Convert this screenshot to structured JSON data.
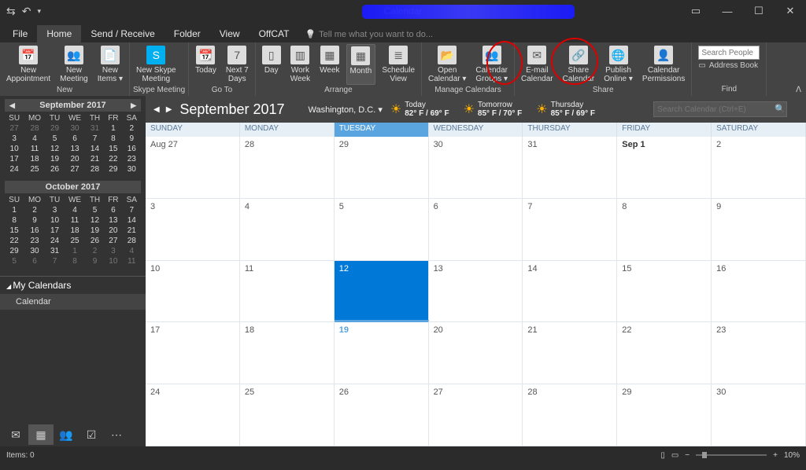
{
  "titlebar": {
    "title": "Calendar"
  },
  "tabs": [
    "File",
    "Home",
    "Send / Receive",
    "Folder",
    "View",
    "OffCAT"
  ],
  "active_tab": "Home",
  "tellme": "Tell me what you want to do...",
  "ribbon": {
    "new": {
      "label": "New",
      "appointment": "New\nAppointment",
      "meeting": "New\nMeeting",
      "items": "New\nItems ▾"
    },
    "skype": {
      "label": "Skype Meeting",
      "btn": "New Skype\nMeeting"
    },
    "goto": {
      "label": "Go To",
      "today": "Today",
      "next7": "Next 7\nDays"
    },
    "arrange": {
      "label": "Arrange",
      "day": "Day",
      "workweek": "Work\nWeek",
      "week": "Week",
      "month": "Month",
      "schedule": "Schedule\nView"
    },
    "manage": {
      "label": "Manage Calendars",
      "open": "Open\nCalendar ▾",
      "groups": "Calendar\nGroups ▾"
    },
    "share": {
      "label": "Share",
      "email": "E-mail\nCalendar",
      "sharebtn": "Share\nCalendar",
      "publish": "Publish\nOnline ▾",
      "perms": "Calendar\nPermissions"
    },
    "find": {
      "label": "Find",
      "search_ph": "Search People",
      "addressbook": "Address Book"
    }
  },
  "minical1": {
    "title": "September 2017",
    "dows": [
      "SU",
      "MO",
      "TU",
      "WE",
      "TH",
      "FR",
      "SA"
    ],
    "rows": [
      [
        "27",
        "28",
        "29",
        "30",
        "31",
        "1",
        "2"
      ],
      [
        "3",
        "4",
        "5",
        "6",
        "7",
        "8",
        "9"
      ],
      [
        "10",
        "11",
        "12",
        "13",
        "14",
        "15",
        "16"
      ],
      [
        "17",
        "18",
        "19",
        "20",
        "21",
        "22",
        "23"
      ],
      [
        "24",
        "25",
        "26",
        "27",
        "28",
        "29",
        "30"
      ]
    ],
    "sel": "19"
  },
  "minical2": {
    "title": "October 2017",
    "dows": [
      "SU",
      "MO",
      "TU",
      "WE",
      "TH",
      "FR",
      "SA"
    ],
    "rows": [
      [
        "1",
        "2",
        "3",
        "4",
        "5",
        "6",
        "7"
      ],
      [
        "8",
        "9",
        "10",
        "11",
        "12",
        "13",
        "14"
      ],
      [
        "15",
        "16",
        "17",
        "18",
        "19",
        "20",
        "21"
      ],
      [
        "22",
        "23",
        "24",
        "25",
        "26",
        "27",
        "28"
      ],
      [
        "29",
        "30",
        "31",
        "1",
        "2",
        "3",
        "4"
      ],
      [
        "5",
        "6",
        "7",
        "8",
        "9",
        "10",
        "11"
      ]
    ]
  },
  "mycalendars": {
    "header": "My Calendars",
    "item": "Calendar"
  },
  "calheader": {
    "month": "September 2017",
    "location": "Washington,  D.C.  ▾",
    "weather": [
      {
        "label": "Today",
        "temp": "82° F / 69° F"
      },
      {
        "label": "Tomorrow",
        "temp": "85° F / 70° F"
      },
      {
        "label": "Thursday",
        "temp": "85° F / 69° F"
      }
    ],
    "search_ph": "Search Calendar (Ctrl+E)"
  },
  "days": [
    "SUNDAY",
    "MONDAY",
    "TUESDAY",
    "WEDNESDAY",
    "THURSDAY",
    "FRIDAY",
    "SATURDAY"
  ],
  "selected_day_idx": 2,
  "grid": [
    [
      {
        "t": "Aug 27"
      },
      {
        "t": "28"
      },
      {
        "t": "29"
      },
      {
        "t": "30"
      },
      {
        "t": "31"
      },
      {
        "t": "Sep 1",
        "b": true
      },
      {
        "t": "2"
      }
    ],
    [
      {
        "t": "3"
      },
      {
        "t": "4"
      },
      {
        "t": "5"
      },
      {
        "t": "6"
      },
      {
        "t": "7"
      },
      {
        "t": "8"
      },
      {
        "t": "9"
      }
    ],
    [
      {
        "t": "10"
      },
      {
        "t": "11"
      },
      {
        "t": "12",
        "sel": true
      },
      {
        "t": "13"
      },
      {
        "t": "14"
      },
      {
        "t": "15"
      },
      {
        "t": "16"
      }
    ],
    [
      {
        "t": "17"
      },
      {
        "t": "18"
      },
      {
        "t": "19",
        "today": true
      },
      {
        "t": "20"
      },
      {
        "t": "21"
      },
      {
        "t": "22"
      },
      {
        "t": "23"
      }
    ],
    [
      {
        "t": "24"
      },
      {
        "t": "25"
      },
      {
        "t": "26"
      },
      {
        "t": "27"
      },
      {
        "t": "28"
      },
      {
        "t": "29"
      },
      {
        "t": "30"
      }
    ]
  ],
  "sidetabs": {
    "prev": "Previous Appointment",
    "next": "Next Appointment"
  },
  "status": {
    "items": "Items: 0",
    "zoom": "10%"
  }
}
